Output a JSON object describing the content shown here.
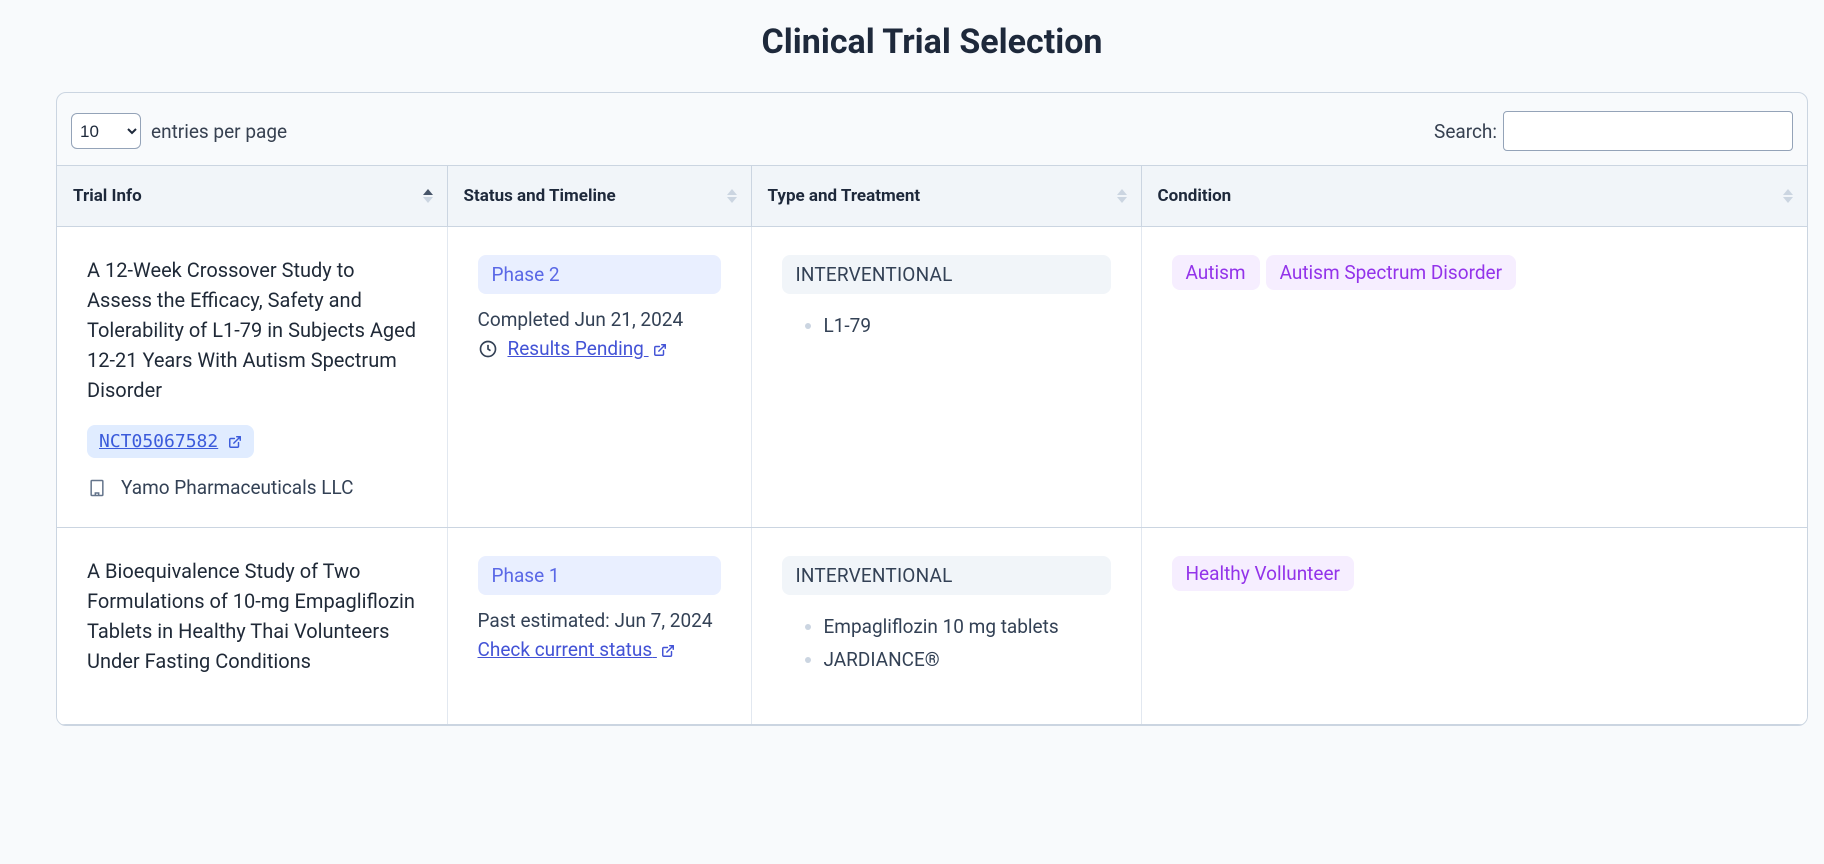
{
  "page_title": "Clinical Trial Selection",
  "controls": {
    "entries_select_value": "10",
    "entries_label": "entries per page",
    "search_label": "Search:",
    "search_value": ""
  },
  "columns": {
    "trial": "Trial Info",
    "status": "Status and Timeline",
    "type": "Type and Treatment",
    "condition": "Condition"
  },
  "rows": [
    {
      "title": "A 12-Week Crossover Study to Assess the Efficacy, Safety and Tolerability of L1-79 in Subjects Aged 12-21 Years With Autism Spectrum Disorder",
      "nct": "NCT05067582",
      "sponsor": "Yamo Pharmaceuticals LLC",
      "phase": "Phase 2",
      "status_text": "Completed Jun 21, 2024",
      "status_link": "Results Pending",
      "status_has_clock": true,
      "type": "INTERVENTIONAL",
      "treatments": [
        "L1-79"
      ],
      "conditions": [
        "Autism",
        "Autism Spectrum Disorder"
      ]
    },
    {
      "title": "A Bioequivalence Study of Two Formulations of 10-mg Empagliflozin Tablets in Healthy Thai Volunteers Under Fasting Conditions",
      "nct": "",
      "sponsor": "",
      "phase": "Phase 1",
      "status_text": "Past estimated: Jun 7, 2024",
      "status_link": "Check current status",
      "status_has_clock": false,
      "type": "INTERVENTIONAL",
      "treatments": [
        "Empagliflozin 10 mg tablets",
        "JARDIANCE®"
      ],
      "conditions": [
        "Healthy Vollunteer"
      ]
    }
  ]
}
